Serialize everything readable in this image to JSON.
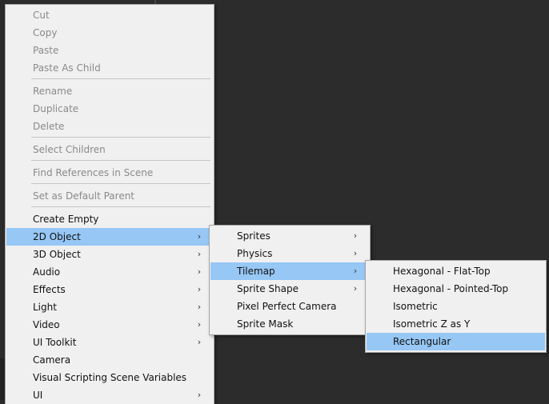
{
  "main_menu": {
    "items": [
      {
        "label": "Cut",
        "disabled": true
      },
      {
        "label": "Copy",
        "disabled": true
      },
      {
        "label": "Paste",
        "disabled": true
      },
      {
        "label": "Paste As Child",
        "disabled": true
      },
      {
        "label": "Rename",
        "disabled": true
      },
      {
        "label": "Duplicate",
        "disabled": true
      },
      {
        "label": "Delete",
        "disabled": true
      },
      {
        "label": "Select Children",
        "disabled": true
      },
      {
        "label": "Find References in Scene",
        "disabled": true
      },
      {
        "label": "Set as Default Parent",
        "disabled": true
      },
      {
        "label": "Create Empty",
        "disabled": false
      },
      {
        "label": "2D Object",
        "submenu": true,
        "selected": true
      },
      {
        "label": "3D Object",
        "submenu": true
      },
      {
        "label": "Audio",
        "submenu": true
      },
      {
        "label": "Effects",
        "submenu": true
      },
      {
        "label": "Light",
        "submenu": true
      },
      {
        "label": "Video",
        "submenu": true
      },
      {
        "label": "UI Toolkit",
        "submenu": true
      },
      {
        "label": "Camera",
        "submenu": false
      },
      {
        "label": "Visual Scripting Scene Variables",
        "submenu": false
      },
      {
        "label": "UI",
        "submenu": true
      }
    ]
  },
  "submenu_2d_object": {
    "items": [
      {
        "label": "Sprites",
        "submenu": true
      },
      {
        "label": "Physics",
        "submenu": true
      },
      {
        "label": "Tilemap",
        "submenu": true,
        "selected": true
      },
      {
        "label": "Sprite Shape",
        "submenu": true
      },
      {
        "label": "Pixel Perfect Camera",
        "submenu": false
      },
      {
        "label": "Sprite Mask",
        "submenu": false
      }
    ]
  },
  "submenu_tilemap": {
    "items": [
      {
        "label": "Hexagonal - Flat-Top"
      },
      {
        "label": "Hexagonal - Pointed-Top"
      },
      {
        "label": "Isometric"
      },
      {
        "label": "Isometric Z as Y"
      },
      {
        "label": "Rectangular",
        "selected": true
      }
    ]
  },
  "icons": {
    "submenu_arrow": "chevron-right-icon"
  },
  "colors": {
    "menu_background": "#f0f0f0",
    "selection": "#96c7f5",
    "disabled_text": "#8a8a8a",
    "editor_background": "#2c2c2c"
  }
}
